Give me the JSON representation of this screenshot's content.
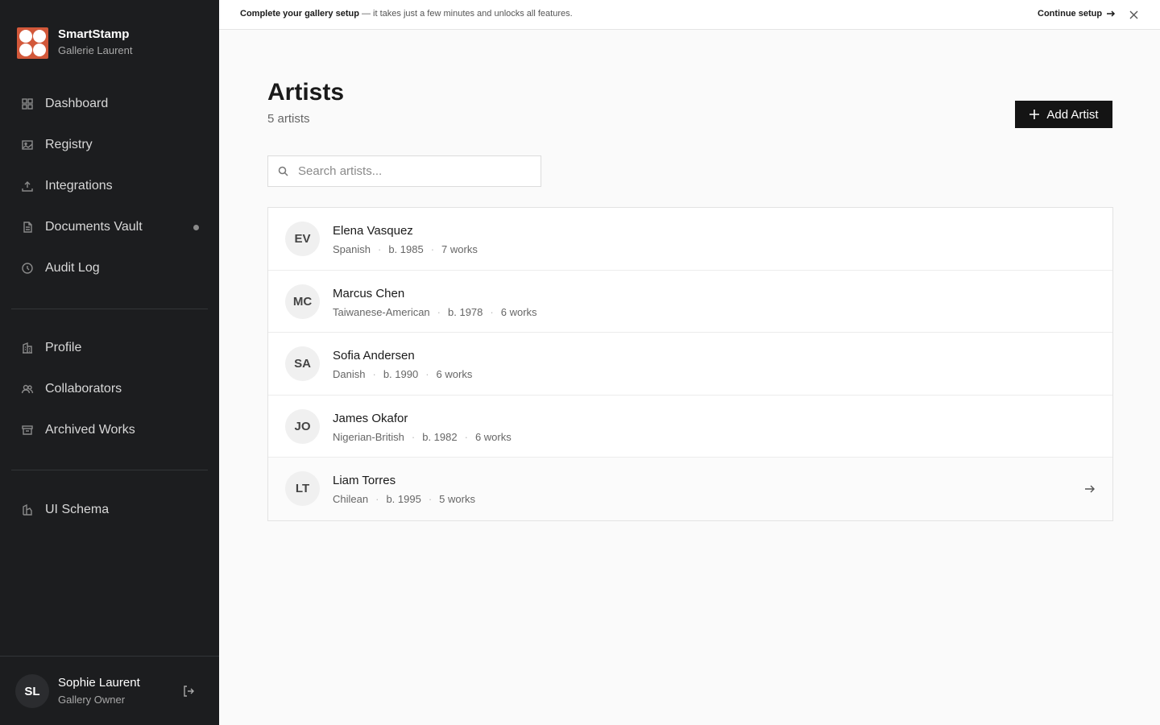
{
  "brand": {
    "name": "SmartStamp",
    "subtitle": "Gallerie Laurent"
  },
  "nav": {
    "primary": [
      {
        "label": "Dashboard",
        "icon": "grid-icon"
      },
      {
        "label": "Registry",
        "icon": "image-icon"
      },
      {
        "label": "Integrations",
        "icon": "upload-icon"
      },
      {
        "label": "Documents Vault",
        "icon": "document-icon",
        "has_dot": true
      },
      {
        "label": "Audit Log",
        "icon": "clock-icon"
      }
    ],
    "secondary": [
      {
        "label": "Profile",
        "icon": "building-icon"
      },
      {
        "label": "Collaborators",
        "icon": "users-icon"
      },
      {
        "label": "Archived Works",
        "icon": "archive-icon"
      }
    ],
    "tertiary": [
      {
        "label": "UI Schema",
        "icon": "schema-icon"
      }
    ]
  },
  "user": {
    "initials": "SL",
    "name": "Sophie Laurent",
    "role": "Gallery Owner"
  },
  "banner": {
    "bold": "Complete your gallery setup",
    "text": " — it takes just a few minutes and unlocks all features.",
    "cta": "Continue setup"
  },
  "page": {
    "title": "Artists",
    "count": "5 artists",
    "add_button": "Add Artist",
    "search_placeholder": "Search artists..."
  },
  "artists": [
    {
      "initials": "EV",
      "name": "Elena Vasquez",
      "nationality": "Spanish",
      "born": "b. 1985",
      "works": "7 works"
    },
    {
      "initials": "MC",
      "name": "Marcus Chen",
      "nationality": "Taiwanese-American",
      "born": "b. 1978",
      "works": "6 works"
    },
    {
      "initials": "SA",
      "name": "Sofia Andersen",
      "nationality": "Danish",
      "born": "b. 1990",
      "works": "6 works"
    },
    {
      "initials": "JO",
      "name": "James Okafor",
      "nationality": "Nigerian-British",
      "born": "b. 1982",
      "works": "6 works"
    },
    {
      "initials": "LT",
      "name": "Liam Torres",
      "nationality": "Chilean",
      "born": "b. 1995",
      "works": "5 works"
    }
  ],
  "colors": {
    "sidebar_bg": "#1c1d1f",
    "brand_accent": "#d2583a",
    "primary_button": "#141414"
  }
}
